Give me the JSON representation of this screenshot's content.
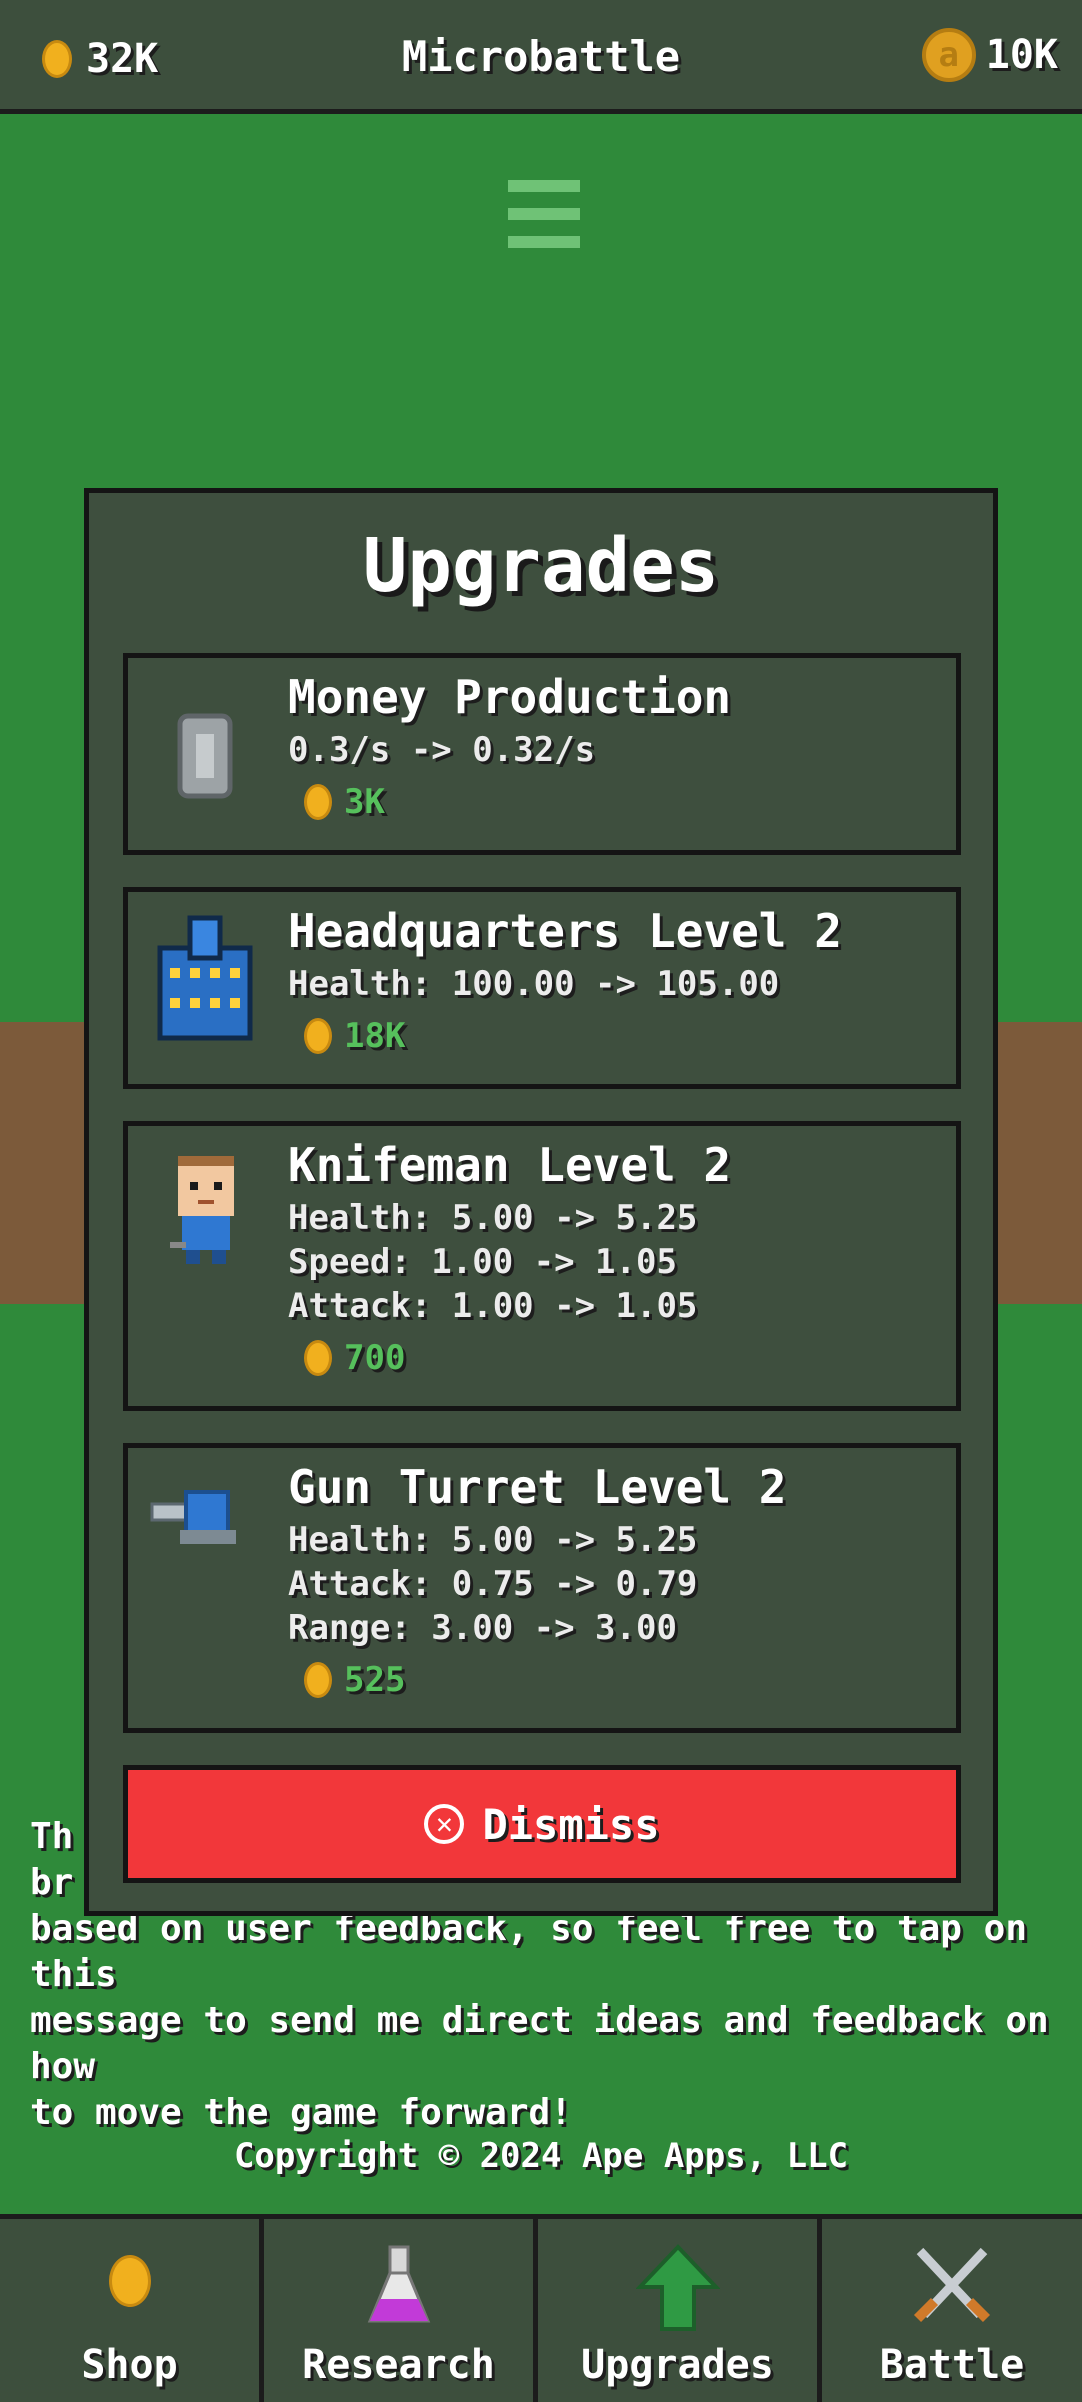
{
  "header": {
    "coins": "32K",
    "title": "Microbattle",
    "ape_coins": "10K",
    "ape_coin_glyph": "a"
  },
  "background_text": {
    "info_visible": "Th\nbr\nbased on user feedback, so feel free to tap on this\nmessage to send me direct ideas and feedback on how\nto move the game forward!",
    "copyright": "Copyright © 2024 Ape Apps, LLC"
  },
  "modal": {
    "title": "Upgrades",
    "cards": [
      {
        "icon": "silver-coin-icon",
        "name": "Money Production",
        "lines": [
          "0.3/s -> 0.32/s"
        ],
        "cost": "3K"
      },
      {
        "icon": "headquarters-icon",
        "name": "Headquarters Level 2",
        "lines": [
          "Health: 100.00 -> 105.00"
        ],
        "cost": "18K"
      },
      {
        "icon": "knifeman-icon",
        "name": "Knifeman Level 2",
        "lines": [
          "Health: 5.00 -> 5.25",
          "Speed: 1.00 -> 1.05",
          "Attack: 1.00 -> 1.05"
        ],
        "cost": "700"
      },
      {
        "icon": "gun-turret-icon",
        "name": "Gun Turret Level 2",
        "lines": [
          "Health: 5.00 -> 5.25",
          "Attack: 0.75 -> 0.79",
          "Range: 3.00 -> 3.00"
        ],
        "cost": "525"
      }
    ],
    "dismiss_label": "Dismiss"
  },
  "nav": {
    "items": [
      {
        "label": "Shop",
        "icon": "coin-icon"
      },
      {
        "label": "Research",
        "icon": "potion-icon"
      },
      {
        "label": "Upgrades",
        "icon": "up-arrow-icon"
      },
      {
        "label": "Battle",
        "icon": "crossed-swords-icon"
      }
    ]
  },
  "colors": {
    "grass": "#2f8a3a",
    "panel": "#3e4f3e",
    "cost_green": "#56c05c",
    "dismiss_red": "#f2373a",
    "gold": "#f1b01e"
  }
}
